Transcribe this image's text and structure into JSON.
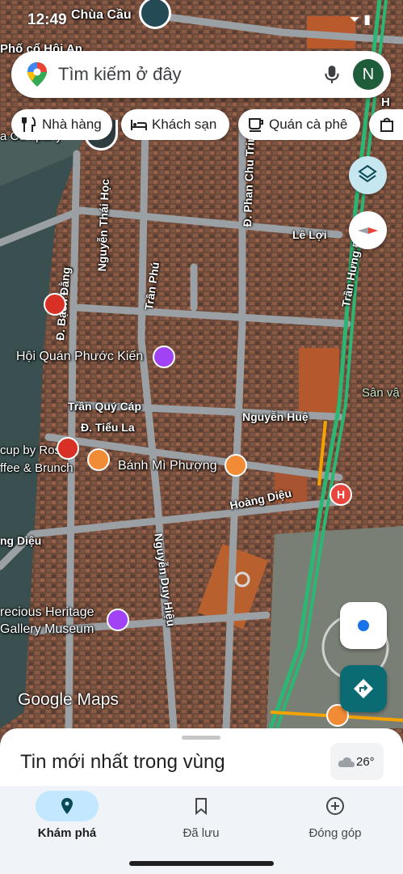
{
  "status_bar": {
    "time": "12:49"
  },
  "search": {
    "placeholder": "Tìm kiếm ở đây",
    "avatar_letter": "N"
  },
  "chips": [
    {
      "label": "Nhà hàng",
      "icon": "restaurant-icon"
    },
    {
      "label": "Khách sạn",
      "icon": "hotel-icon"
    },
    {
      "label": "Quán cà phê",
      "icon": "coffee-icon"
    },
    {
      "label": "",
      "icon": "shopping-icon"
    }
  ],
  "map_labels": {
    "chua_cau": "Chùa Cầu",
    "pho_co": "Phố cổ Hội An",
    "nguyen_thai_hoc": "Nguyễn Thái Học",
    "tran_phu": "Trần Phú",
    "phan_chu_trinh": "Đ. Phan Chu Trinh",
    "le_loi": "Lê Lợi",
    "tran_hung_dao": "Trần Hưng Đạo",
    "bach_dang": "Đ. Bạch Đằng",
    "hoi_quan": "Hội Quán Phước Kiến",
    "tran_quy_cap": "Trần Quý Cáp",
    "tieu_la": "Đ. Tiểu La",
    "nguyen_hue": "Nguyễn Huệ",
    "san_van": "Sân vậ",
    "cup_by_ros_1": "cup by Ros",
    "cup_by_ros_2": "ffee & Brunch",
    "banh_mi": "Bánh Mì Phượng",
    "hoang_dieu": "Hoàng Diệu",
    "hoang_dieu_left": "ng Diệu",
    "nguyen_duy_hieu": "Nguyễn Duy Hiệu",
    "heritage_1": "recious Heritage",
    "heritage_2": "Gallery Museum",
    "top_right": "H",
    "company": "a Company"
  },
  "watermark": "Google Maps",
  "sheet": {
    "title": "Tin mới nhất trong vùng"
  },
  "weather": {
    "temp": "26°"
  },
  "nav": [
    {
      "label": "Khám phá",
      "icon": "explore-pin-icon",
      "active": true
    },
    {
      "label": "Đã lưu",
      "icon": "bookmark-icon",
      "active": false
    },
    {
      "label": "Đóng góp",
      "icon": "add-circle-icon",
      "active": false
    }
  ],
  "colors": {
    "accent": "#c2e7ff",
    "directions": "#0b6b72",
    "avatar": "#1e5c3a"
  }
}
